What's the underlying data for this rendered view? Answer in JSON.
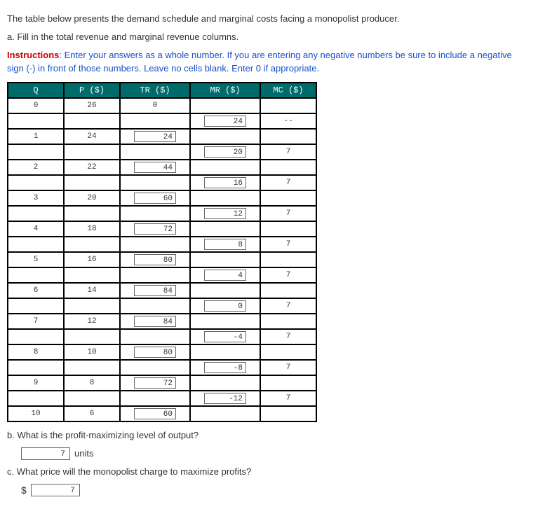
{
  "intro1": "The table below presents the demand schedule and marginal costs facing a monopolist producer.",
  "intro2": "a. Fill in the total revenue and marginal revenue columns.",
  "instructions_label": "Instructions",
  "instructions_text": ": Enter your answers as a whole number. If you are entering any negative numbers be sure to include a negative sign (-) in front of those numbers. Leave no cells blank. Enter 0 if appropriate.",
  "headers": {
    "q": "Q",
    "p": "P ($)",
    "tr": "TR ($)",
    "mr": "MR ($)",
    "mc": "MC ($)"
  },
  "rows": [
    {
      "q": "0",
      "p": "26",
      "tr": "0",
      "mr_after": "24",
      "mc_after": "--"
    },
    {
      "q": "1",
      "p": "24",
      "tr": "24",
      "mr_after": "20",
      "mc_after": "7"
    },
    {
      "q": "2",
      "p": "22",
      "tr": "44",
      "mr_after": "16",
      "mc_after": "7"
    },
    {
      "q": "3",
      "p": "20",
      "tr": "60",
      "mr_after": "12",
      "mc_after": "7"
    },
    {
      "q": "4",
      "p": "18",
      "tr": "72",
      "mr_after": "8",
      "mc_after": "7"
    },
    {
      "q": "5",
      "p": "16",
      "tr": "80",
      "mr_after": "4",
      "mc_after": "7"
    },
    {
      "q": "6",
      "p": "14",
      "tr": "84",
      "mr_after": "0",
      "mc_after": "7"
    },
    {
      "q": "7",
      "p": "12",
      "tr": "84",
      "mr_after": "-4",
      "mc_after": "7"
    },
    {
      "q": "8",
      "p": "10",
      "tr": "80",
      "mr_after": "-8",
      "mc_after": "7"
    },
    {
      "q": "9",
      "p": "8",
      "tr": "72",
      "mr_after": "-12",
      "mc_after": "7"
    },
    {
      "q": "10",
      "p": "6",
      "tr": "60"
    }
  ],
  "question_b": "b. What is the profit-maximizing level of output?",
  "answer_b": {
    "value": "7",
    "unit": "units"
  },
  "question_c": "c. What price will the monopolist charge to maximize profits?",
  "answer_c": {
    "currency": "$",
    "value": "7"
  }
}
